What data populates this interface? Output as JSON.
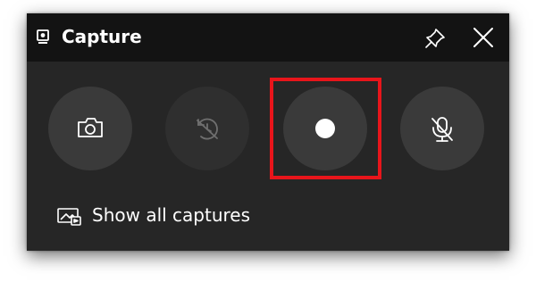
{
  "window": {
    "title": "Capture",
    "icon": "widget-icon",
    "actions": [
      {
        "name": "pin",
        "icon": "pin-icon"
      },
      {
        "name": "close",
        "icon": "close-icon"
      }
    ]
  },
  "controls": [
    {
      "name": "screenshot",
      "icon": "camera-icon",
      "enabled": true
    },
    {
      "name": "record-last",
      "icon": "record-last-icon",
      "enabled": false
    },
    {
      "name": "start-recording",
      "icon": "record-dot-icon",
      "enabled": true,
      "highlighted": true
    },
    {
      "name": "microphone",
      "icon": "mic-off-icon",
      "enabled": true
    }
  ],
  "footer": {
    "show_all_label": "Show all captures",
    "icon": "gallery-icon"
  },
  "colors": {
    "panel": "#262626",
    "titlebar": "#131313",
    "button": "#3a3a3a",
    "button_disabled": "#2f2f2f",
    "highlight": "#e8151b",
    "text": "#ffffff"
  }
}
